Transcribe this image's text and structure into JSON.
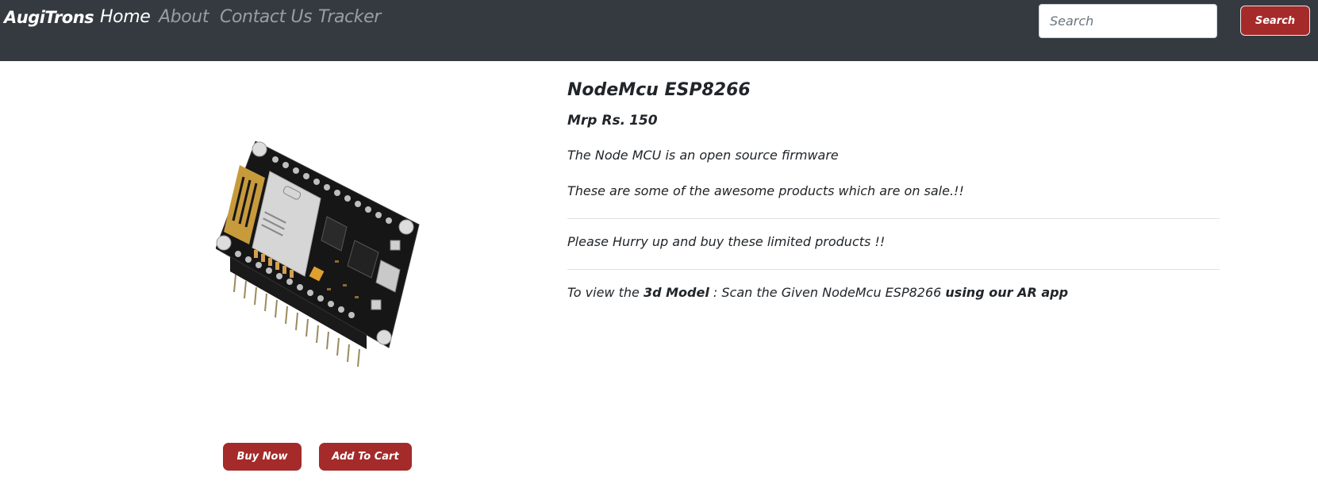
{
  "navbar": {
    "brand": "AugiTrons",
    "links": [
      {
        "label": "Home",
        "active": true
      },
      {
        "label": "About",
        "active": false
      },
      {
        "label": "Contact Us",
        "active": false
      },
      {
        "label": "Tracker",
        "active": false
      }
    ],
    "search": {
      "placeholder": "Search",
      "value": "",
      "button_label": "Search"
    },
    "background_color": "#343a40"
  },
  "product": {
    "image_icon": "nodemcu-board-image",
    "title": "NodeMcu ESP8266",
    "price_label": "Mrp Rs.",
    "price": "150",
    "description": "The Node MCU is an open source firmware",
    "sale_text": "These are some of the awesome products which are on sale.!!",
    "hurry_text": "Please Hurry up and buy these limited products !!",
    "view_3d": {
      "prefix": "To view the",
      "model_label": "3d Model",
      "middle": ": Scan the Given NodeMcu ESP8266",
      "app_label": "using our AR app"
    },
    "buttons": {
      "buy_now": "Buy Now",
      "add_to_cart": "Add To Cart"
    },
    "accent_color": "#a52a2a"
  }
}
